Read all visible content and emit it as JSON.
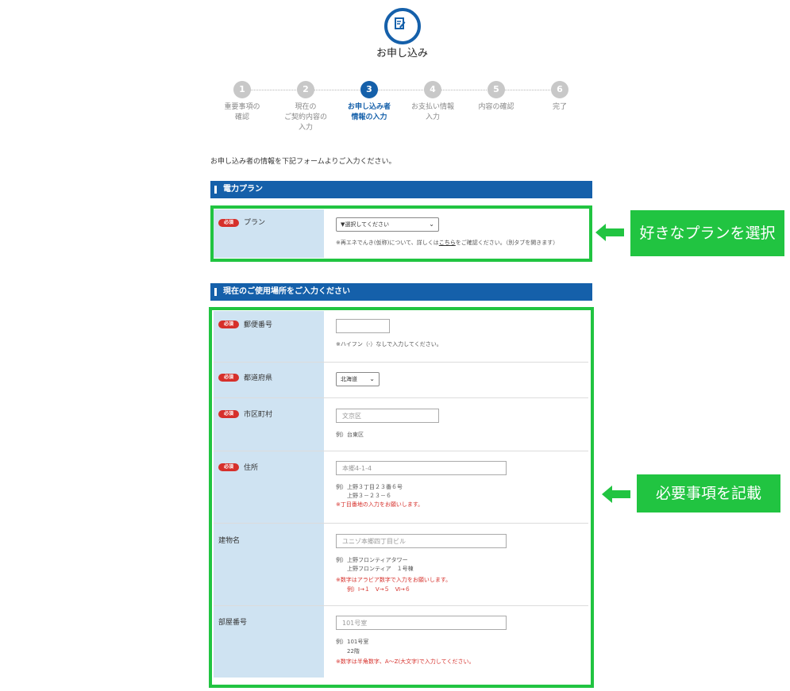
{
  "header": {
    "title": "お申し込み",
    "icon": "edit-document-icon",
    "accent": "#1560aa"
  },
  "steps": [
    {
      "number": "1",
      "label": "重要事項の\n確認"
    },
    {
      "number": "2",
      "label": "現在の\nご契約内容の\n入力"
    },
    {
      "number": "3",
      "label": "お申し込み者\n情報の入力",
      "active": true
    },
    {
      "number": "4",
      "label": "お支払い情報\n入力"
    },
    {
      "number": "5",
      "label": "内容の確認"
    },
    {
      "number": "6",
      "label": "完了"
    }
  ],
  "intro": "お申し込み者の情報を下記フォームよりご入力ください。",
  "required_badge": "必須",
  "plan_section": {
    "title": "電力プラン",
    "label": "プラン",
    "select_value": "▼選択してください",
    "note_before": "※再エネでんき(仮称)について、詳しくは",
    "note_link": "こちら",
    "note_after": "をご確認ください。（別タブを開きます）"
  },
  "location_section": {
    "title": "現在のご使用場所をご入力ください",
    "postal": {
      "label": "郵便番号",
      "value": "",
      "note": "※ハイフン（-）なしで入力してください。"
    },
    "prefecture": {
      "label": "都道府県",
      "value": "北海道"
    },
    "city": {
      "label": "市区町村",
      "placeholder": "文京区",
      "example": "例）台東区"
    },
    "address": {
      "label": "住所",
      "placeholder": "本郷4-1-4",
      "example1": "例）上野３丁目２３番６号",
      "example2": "　　上野３－２３－６",
      "warning": "※丁目番地の入力をお願いします。"
    },
    "building": {
      "label": "建物名",
      "placeholder": "ユニゾ本郷四丁目ビル",
      "example1": "例）上野フロンティアタワー",
      "example2": "　　上野フロンティア　１号棟",
      "warning1": "※数字はアラビア数字で入力をお願いします。",
      "warning2": "　　例）Ⅰ→１　Ⅴ→５　Ⅵ→６"
    },
    "room": {
      "label": "部屋番号",
      "placeholder": "101号室",
      "example1": "例）101号室",
      "example2": "　　22階",
      "warning": "※数字は半角数字、A～Z(大文字)で入力してください。"
    }
  },
  "callouts": {
    "plan": "好きなプランを選択",
    "fields": "必要事項を記載",
    "color": "#21c441"
  }
}
